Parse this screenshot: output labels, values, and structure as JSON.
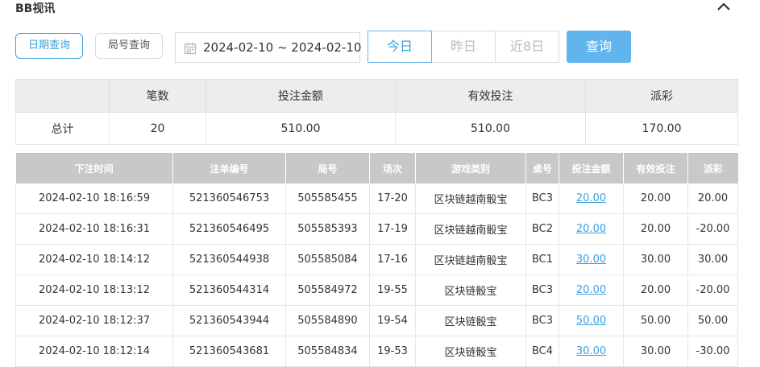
{
  "header": {
    "title": "BB视讯",
    "collapse_icon": "chevron-up-icon"
  },
  "filters": {
    "by_date_label": "日期查询",
    "by_round_label": "局号查询",
    "date_range": "2024-02-10 ~ 2024-02-10",
    "calendar_icon": "calendar-icon",
    "today_label": "今日",
    "yesterday_label": "昨日",
    "last8_label": "近8日",
    "query_label": "查询"
  },
  "summary": {
    "headers": [
      "",
      "笔数",
      "投注金额",
      "有效投注",
      "派彩"
    ],
    "row": [
      "总计",
      "20",
      "510.00",
      "510.00",
      "170.00"
    ]
  },
  "detail": {
    "headers": [
      "下注时间",
      "注单编号",
      "局号",
      "场次",
      "游戏类别",
      "桌号",
      "投注金额",
      "有效投注",
      "派彩"
    ],
    "rows": [
      [
        "2024-02-10 18:16:59",
        "521360546753",
        "505585455",
        "17-20",
        "区块链越南骰宝",
        "BC3",
        "20.00",
        "20.00",
        "20.00"
      ],
      [
        "2024-02-10 18:16:31",
        "521360546495",
        "505585393",
        "17-19",
        "区块链越南骰宝",
        "BC2",
        "20.00",
        "20.00",
        "-20.00"
      ],
      [
        "2024-02-10 18:14:12",
        "521360544938",
        "505585084",
        "17-16",
        "区块链越南骰宝",
        "BC1",
        "30.00",
        "30.00",
        "30.00"
      ],
      [
        "2024-02-10 18:13:12",
        "521360544314",
        "505584972",
        "19-55",
        "区块链骰宝",
        "BC3",
        "20.00",
        "20.00",
        "-20.00"
      ],
      [
        "2024-02-10 18:12:37",
        "521360543944",
        "505584890",
        "19-54",
        "区块链骰宝",
        "BC3",
        "50.00",
        "50.00",
        "50.00"
      ],
      [
        "2024-02-10 18:12:14",
        "521360543681",
        "505584834",
        "19-53",
        "区块链骰宝",
        "BC4",
        "30.00",
        "30.00",
        "-30.00"
      ]
    ]
  },
  "colors": {
    "accent": "#3aa0e0",
    "query_button": "#62b4ee",
    "negative": "#e0393e",
    "header_gray": "#c8c8c8"
  }
}
